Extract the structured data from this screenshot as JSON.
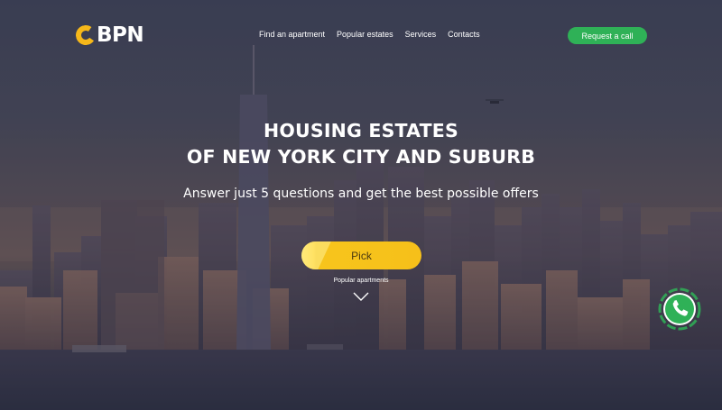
{
  "brand": {
    "logo_text": "BPN",
    "accent": "#f6b81a"
  },
  "nav": {
    "items": [
      {
        "label": "Find an apartment"
      },
      {
        "label": "Popular estates"
      },
      {
        "label": "Services"
      },
      {
        "label": "Contacts"
      }
    ]
  },
  "header": {
    "call_button_label": "Request a call",
    "call_button_color": "#2fb157"
  },
  "hero": {
    "title_line1": "HOUSING ESTATES",
    "title_line2": "OF NEW YORK CITY AND SUBURB",
    "subtitle": "Answer just 5 questions and get the best possible offers",
    "pick_button_label": "Pick",
    "pick_button_color": "#f6c01a",
    "popular_label": "Popular apartments",
    "scroll_icon": "chevron-down-icon"
  },
  "floating": {
    "icon": "phone-icon",
    "color": "#2fb157"
  }
}
